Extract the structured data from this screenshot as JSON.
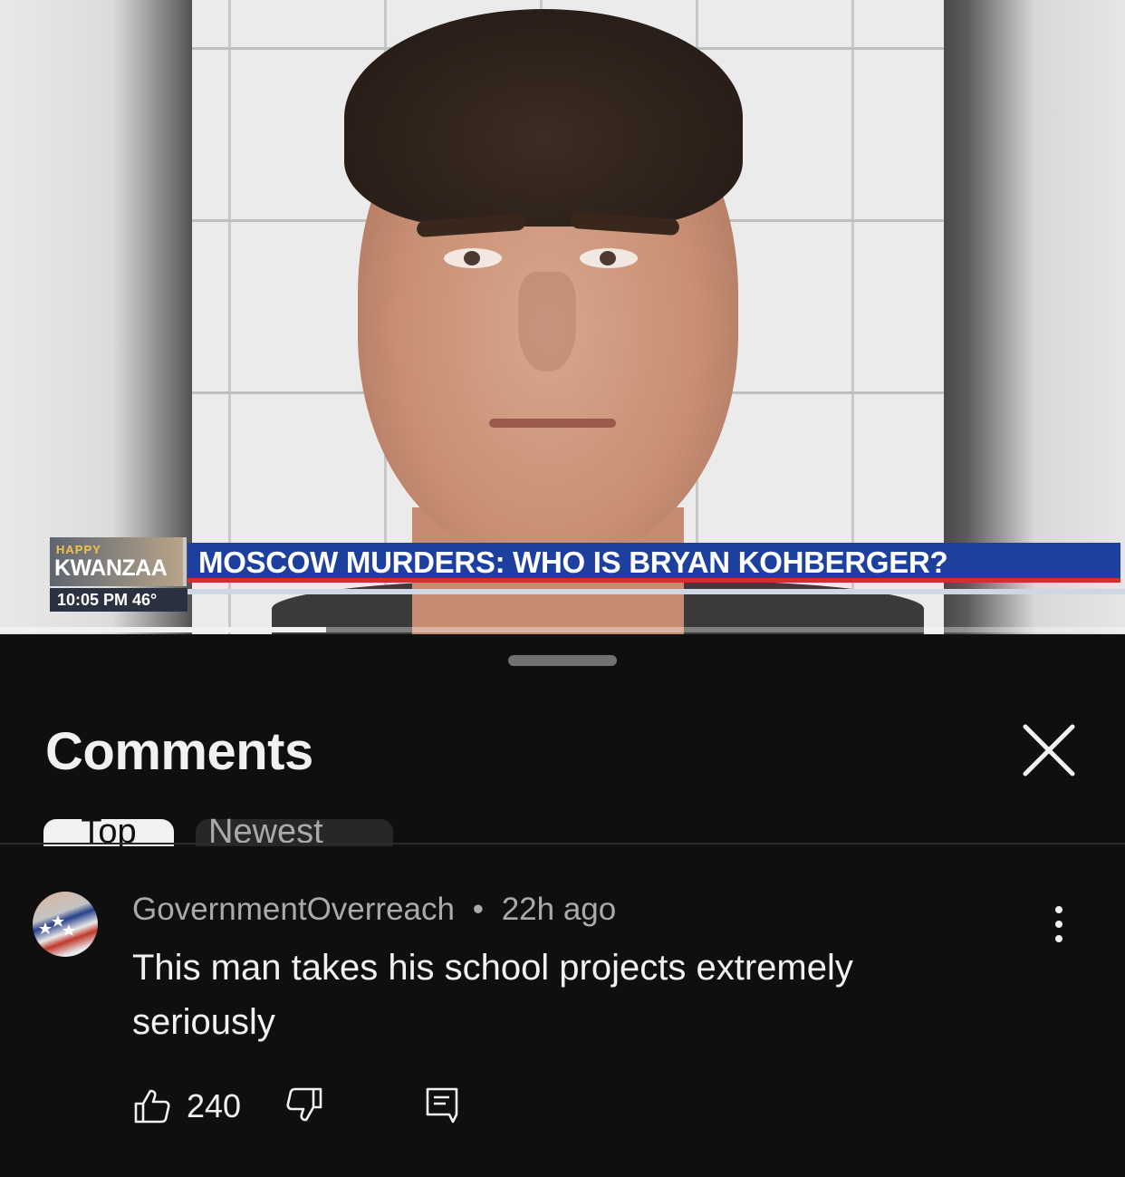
{
  "video": {
    "lower_third": {
      "happy": "HAPPY",
      "kwanzaa": "KWANZAA",
      "headline": "MOSCOW MURDERS: WHO IS BRYAN KOHBERGER?",
      "time_temp": "10:05 PM  46°"
    },
    "progress_fraction": 0.29
  },
  "comments": {
    "title": "Comments",
    "sort_chips": [
      {
        "label": "Top",
        "active": true
      },
      {
        "label": "Newest",
        "active": false
      }
    ],
    "items": [
      {
        "author": "GovernmentOverreach",
        "separator": "•",
        "time": "22h ago",
        "text": "This man takes his school projects extremely seriously",
        "likes": "240",
        "avatar_icon": "flag-avatar-icon"
      }
    ]
  },
  "icons": {
    "close": "close-icon",
    "more": "more-vert-icon",
    "like": "thumbs-up-icon",
    "dislike": "thumbs-down-icon",
    "reply": "reply-icon"
  },
  "colors": {
    "background": "#0f0f0f",
    "text_primary": "#f1f1f1",
    "text_secondary": "#aaaaaa",
    "headline_blue": "#1d3f9e",
    "headline_red": "#d32f2f"
  }
}
